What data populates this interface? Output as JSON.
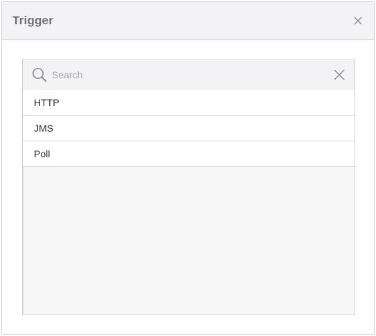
{
  "dialog": {
    "title": "Trigger",
    "close_icon": "close-icon"
  },
  "search": {
    "placeholder": "Search",
    "value": "",
    "search_icon": "search-icon",
    "clear_icon": "clear-icon"
  },
  "list": {
    "items": [
      {
        "label": "HTTP"
      },
      {
        "label": "JMS"
      },
      {
        "label": "Poll"
      }
    ]
  }
}
